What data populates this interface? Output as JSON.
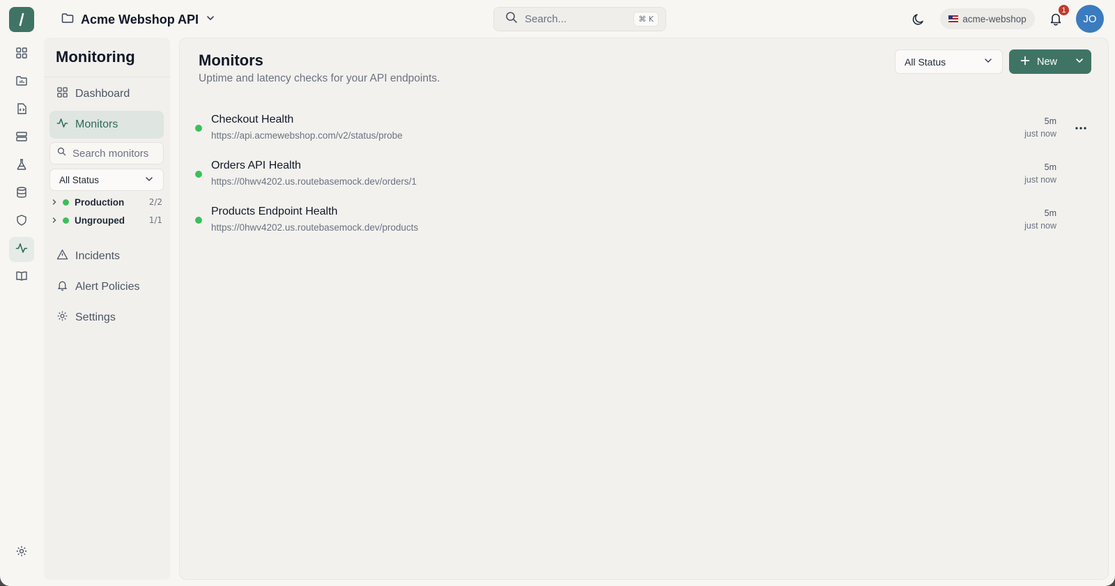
{
  "topbar": {
    "project_name": "Acme Webshop API",
    "search_placeholder": "Search...",
    "search_shortcut": "⌘ K",
    "org_name": "acme-webshop",
    "notification_count": "1",
    "user_initials": "JO"
  },
  "sidebar": {
    "title": "Monitoring",
    "nav": {
      "dashboard": "Dashboard",
      "monitors": "Monitors",
      "incidents": "Incidents",
      "alert_policies": "Alert Policies",
      "settings": "Settings"
    },
    "search_placeholder": "Search monitors",
    "status_filter": "All Status",
    "groups": [
      {
        "name": "Production",
        "count": "2/2"
      },
      {
        "name": "Ungrouped",
        "count": "1/1"
      }
    ]
  },
  "main": {
    "title": "Monitors",
    "subtitle": "Uptime and latency checks for your API endpoints.",
    "status_filter": "All Status",
    "new_button": "New",
    "monitors": [
      {
        "name": "Checkout Health",
        "url": "https://api.acmewebshop.com/v2/status/probe",
        "interval": "5m",
        "last_check": "just now",
        "status": "up"
      },
      {
        "name": "Orders API Health",
        "url": "https://0hwv4202.us.routebasemock.dev/orders/1",
        "interval": "5m",
        "last_check": "just now",
        "status": "up"
      },
      {
        "name": "Products Endpoint Health",
        "url": "https://0hwv4202.us.routebasemock.dev/products",
        "interval": "5m",
        "last_check": "just now",
        "status": "up"
      }
    ]
  },
  "colors": {
    "accent": "#3f7464",
    "status_up": "#3cbf5a",
    "notification_badge": "#c0392b",
    "avatar": "#3b7bbf"
  },
  "icons": {
    "rail": [
      "grid-icon",
      "folder-icon",
      "code-file-icon",
      "server-icon",
      "flask-icon",
      "database-icon",
      "shield-icon",
      "activity-icon",
      "book-icon",
      "gear-icon"
    ]
  }
}
